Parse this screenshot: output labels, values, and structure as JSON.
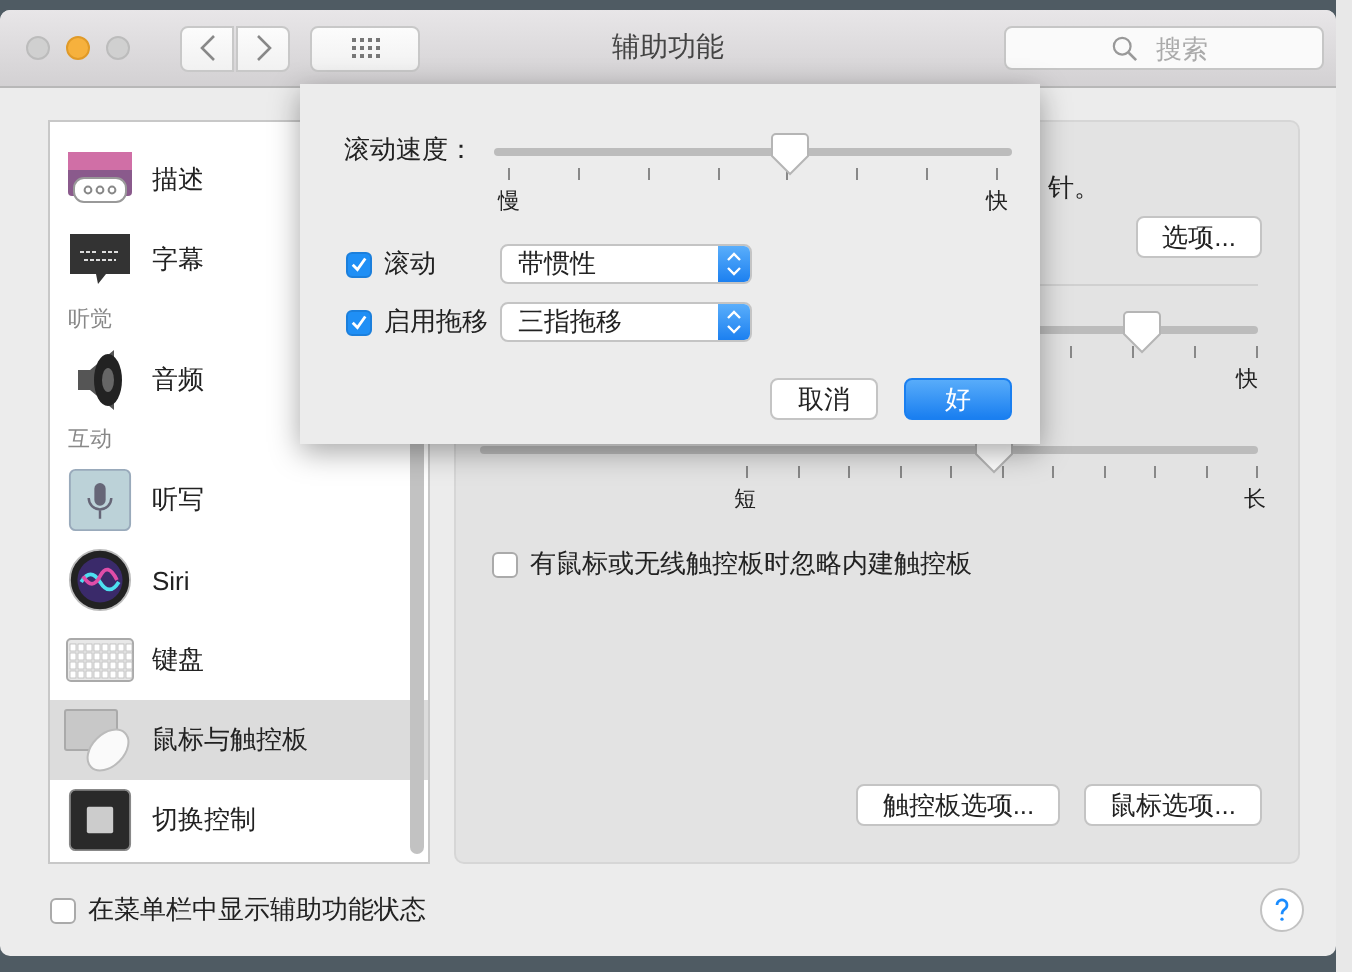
{
  "window": {
    "title": "辅助功能",
    "search": {
      "placeholder": "搜索"
    }
  },
  "sidebar": {
    "items": [
      {
        "kind": "item",
        "label": "描述",
        "selected": false
      },
      {
        "kind": "item",
        "label": "字幕",
        "selected": false
      },
      {
        "kind": "header",
        "label": "听觉"
      },
      {
        "kind": "item",
        "label": "音频",
        "selected": false
      },
      {
        "kind": "header",
        "label": "互动"
      },
      {
        "kind": "item",
        "label": "听写",
        "selected": false
      },
      {
        "kind": "item",
        "label": "Siri",
        "selected": false
      },
      {
        "kind": "item",
        "label": "键盘",
        "selected": false
      },
      {
        "kind": "item",
        "label": "鼠标与触控板",
        "selected": true
      },
      {
        "kind": "item",
        "label": "切换控制",
        "selected": false
      }
    ]
  },
  "panel": {
    "partial_text": "针。",
    "options_button": "选项...",
    "tracking_slider": {
      "level": 0.85,
      "max_label": "快"
    },
    "delay_slider": {
      "level": 0.66,
      "min_label": "短",
      "max_label": "长"
    },
    "ignore_checkbox": {
      "label": "有鼠标或无线触控板时忽略内建触控板",
      "checked": false
    },
    "buttons": [
      "触控板选项...",
      "鼠标选项..."
    ]
  },
  "footer": {
    "menu_checkbox": {
      "label": "在菜单栏中显示辅助功能状态",
      "checked": false
    }
  },
  "sheet": {
    "speed_slider": {
      "label": "滚动速度：",
      "level": 0.57,
      "min_label": "慢",
      "max_label": "快"
    },
    "options": [
      {
        "label": "滚动",
        "checked": true,
        "value": "带惯性"
      },
      {
        "label": "启用拖移",
        "checked": true,
        "value": "三指拖移"
      }
    ],
    "buttons": [
      {
        "label": "取消",
        "kind": "cancel"
      },
      {
        "label": "好",
        "kind": "default"
      }
    ]
  }
}
